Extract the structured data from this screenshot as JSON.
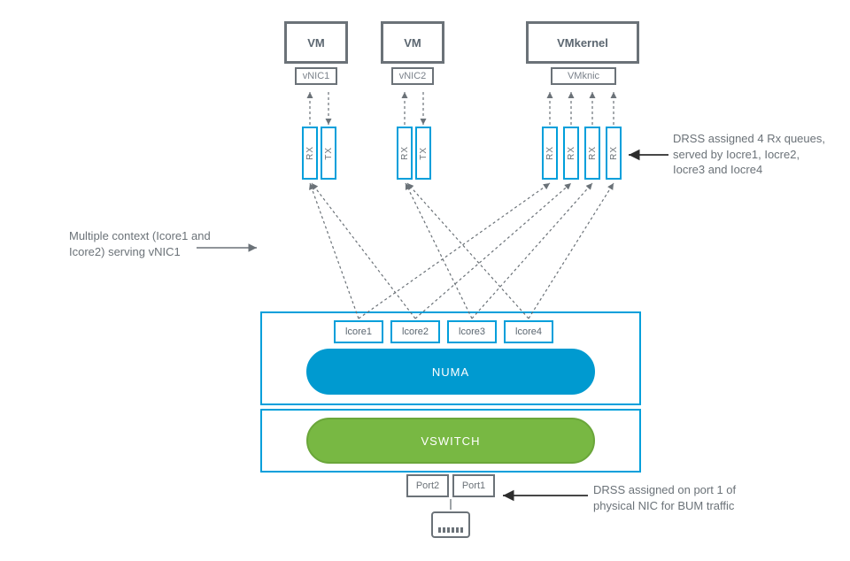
{
  "vm1": {
    "label": "VM",
    "nic": "vNIC1"
  },
  "vm2": {
    "label": "VM",
    "nic": "vNIC2"
  },
  "vmk": {
    "label": "VMkernel",
    "nic": "VMknic"
  },
  "queues": {
    "vm1": [
      "RX",
      "TX"
    ],
    "vm2": [
      "RX",
      "TX"
    ],
    "vmk": [
      "RX",
      "RX",
      "RX",
      "RX"
    ]
  },
  "lcores": [
    "lcore1",
    "lcore2",
    "lcore3",
    "lcore4"
  ],
  "numa": "NUMA",
  "vswitch": "VSWITCH",
  "ports": [
    "Port2",
    "Port1"
  ],
  "annot_left": "Multiple context (Icore1 and Icore2) serving vNIC1",
  "annot_right_top": "DRSS assigned 4 Rx queues, served by Iocre1, Iocre2, Iocre3 and Iocre4",
  "annot_right_bot": "DRSS assigned on port 1 of physical NIC for BUM traffic"
}
